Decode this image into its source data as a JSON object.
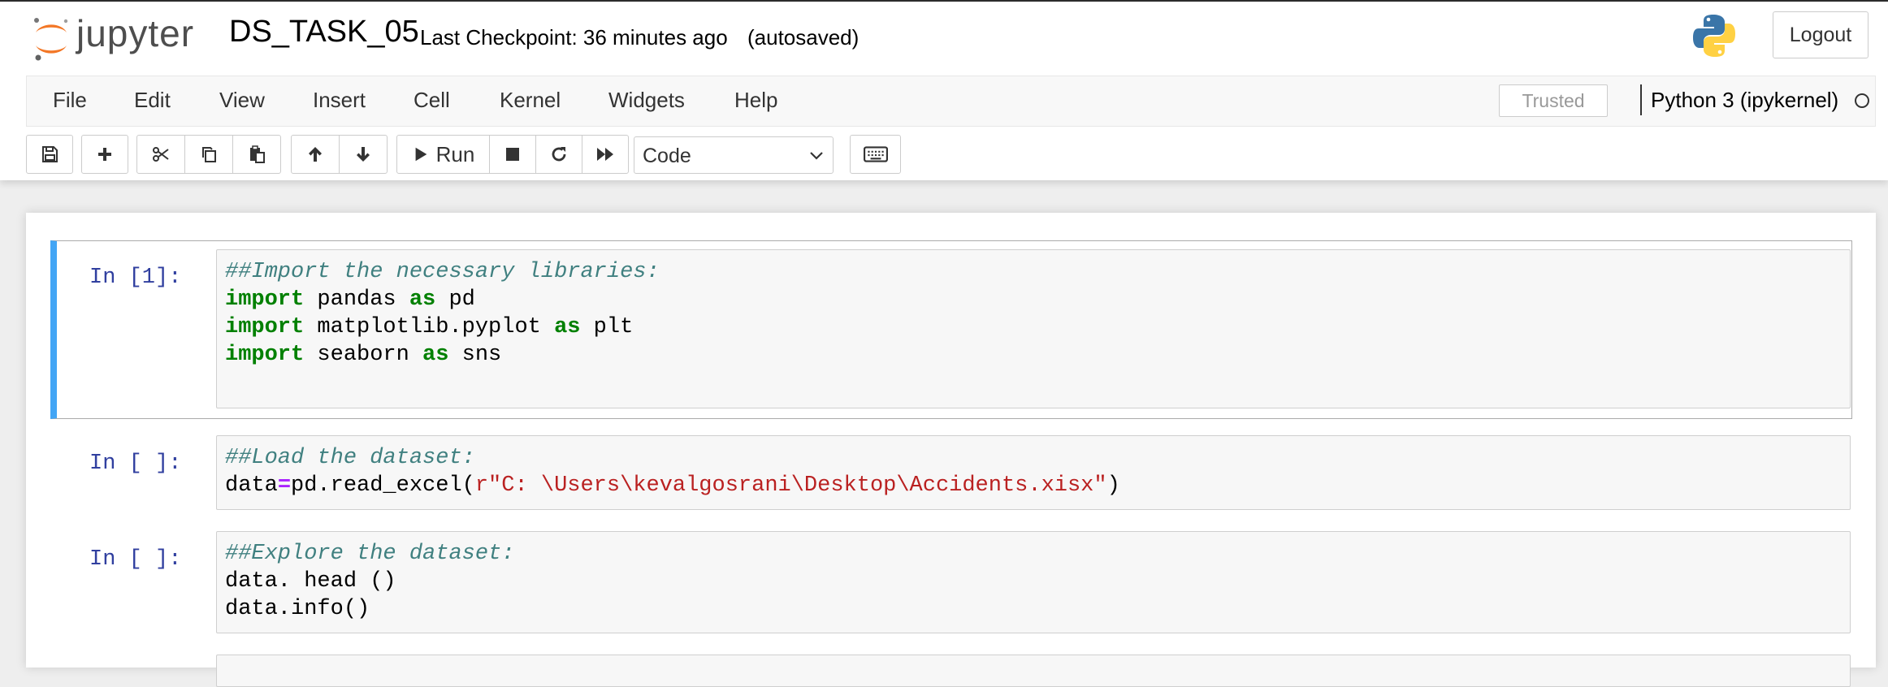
{
  "app": {
    "logo_text": "jupyter",
    "notebook_name": "DS_TASK_05",
    "checkpoint": "Last Checkpoint: 36 minutes ago",
    "autosave_status": "(autosaved)",
    "logout_label": "Logout"
  },
  "menu": {
    "items": [
      "File",
      "Edit",
      "View",
      "Insert",
      "Cell",
      "Kernel",
      "Widgets",
      "Help"
    ],
    "trusted": "Trusted",
    "kernel_name": "Python 3 (ipykernel)"
  },
  "toolbar": {
    "run_label": "Run",
    "cell_type_selected": "Code",
    "icons": [
      "save-icon",
      "plus-icon",
      "scissors-icon",
      "copy-icon",
      "paste-icon",
      "arrow-up-icon",
      "arrow-down-icon",
      "play-icon",
      "stop-icon",
      "restart-icon",
      "fast-forward-icon",
      "keyboard-icon"
    ]
  },
  "colors": {
    "selected_border": "#42a5f5",
    "prompt": "#303f9f",
    "comment": "#408080",
    "keyword": "#008000",
    "string": "#ba2121",
    "operator": "#aa22ff"
  },
  "cells": [
    {
      "prompt": "In [1]:",
      "lines": [
        [
          {
            "t": "##Import the necessary libraries:",
            "c": "comment"
          }
        ],
        [
          {
            "t": "import",
            "c": "kw"
          },
          {
            "t": " pandas ",
            "c": ""
          },
          {
            "t": "as",
            "c": "kw"
          },
          {
            "t": " pd",
            "c": ""
          }
        ],
        [
          {
            "t": "import",
            "c": "kw"
          },
          {
            "t": " matplotlib.pyplot ",
            "c": ""
          },
          {
            "t": "as",
            "c": "kw"
          },
          {
            "t": " plt",
            "c": ""
          }
        ],
        [
          {
            "t": "import",
            "c": "kw"
          },
          {
            "t": " seaborn ",
            "c": ""
          },
          {
            "t": "as",
            "c": "kw"
          },
          {
            "t": " sns",
            "c": ""
          }
        ],
        []
      ]
    },
    {
      "prompt": "In [ ]:",
      "lines": [
        [
          {
            "t": "##Load the dataset:",
            "c": "comment"
          }
        ],
        [
          {
            "t": "data",
            "c": ""
          },
          {
            "t": "=",
            "c": "op"
          },
          {
            "t": "pd.read_excel(",
            "c": ""
          },
          {
            "t": "r\"C: \\Users\\kevalgosrani\\Desktop\\Accidents.xisx\"",
            "c": "str"
          },
          {
            "t": ")",
            "c": ""
          }
        ]
      ]
    },
    {
      "prompt": "In [ ]:",
      "lines": [
        [
          {
            "t": "##Explore the dataset:",
            "c": "comment"
          }
        ],
        [
          {
            "t": "data. head ()",
            "c": ""
          }
        ],
        [
          {
            "t": "data.info()",
            "c": ""
          }
        ]
      ]
    },
    {
      "prompt": "",
      "lines": []
    }
  ]
}
